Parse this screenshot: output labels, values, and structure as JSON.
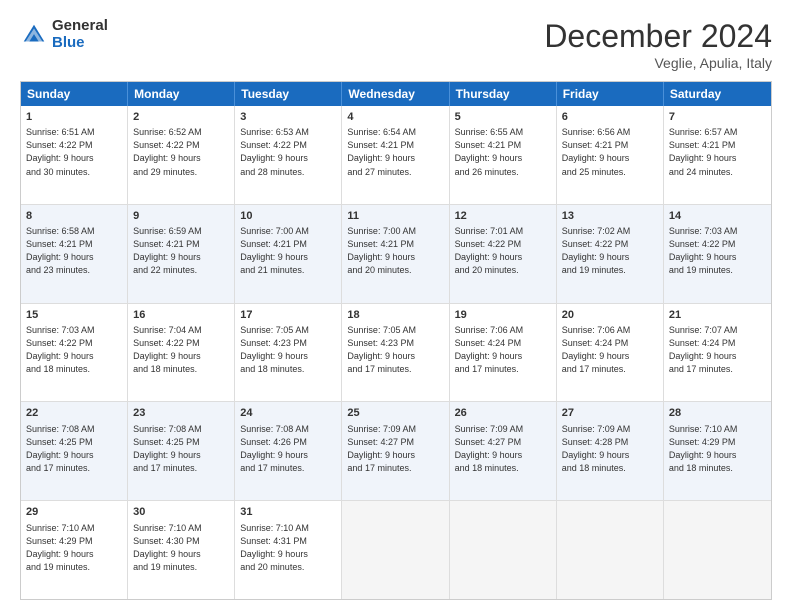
{
  "logo": {
    "general": "General",
    "blue": "Blue"
  },
  "title": {
    "month": "December 2024",
    "location": "Veglie, Apulia, Italy"
  },
  "headers": [
    "Sunday",
    "Monday",
    "Tuesday",
    "Wednesday",
    "Thursday",
    "Friday",
    "Saturday"
  ],
  "rows": [
    [
      {
        "day": "1",
        "info": "Sunrise: 6:51 AM\nSunset: 4:22 PM\nDaylight: 9 hours\nand 30 minutes.",
        "alt": false
      },
      {
        "day": "2",
        "info": "Sunrise: 6:52 AM\nSunset: 4:22 PM\nDaylight: 9 hours\nand 29 minutes.",
        "alt": false
      },
      {
        "day": "3",
        "info": "Sunrise: 6:53 AM\nSunset: 4:22 PM\nDaylight: 9 hours\nand 28 minutes.",
        "alt": false
      },
      {
        "day": "4",
        "info": "Sunrise: 6:54 AM\nSunset: 4:21 PM\nDaylight: 9 hours\nand 27 minutes.",
        "alt": false
      },
      {
        "day": "5",
        "info": "Sunrise: 6:55 AM\nSunset: 4:21 PM\nDaylight: 9 hours\nand 26 minutes.",
        "alt": false
      },
      {
        "day": "6",
        "info": "Sunrise: 6:56 AM\nSunset: 4:21 PM\nDaylight: 9 hours\nand 25 minutes.",
        "alt": false
      },
      {
        "day": "7",
        "info": "Sunrise: 6:57 AM\nSunset: 4:21 PM\nDaylight: 9 hours\nand 24 minutes.",
        "alt": false
      }
    ],
    [
      {
        "day": "8",
        "info": "Sunrise: 6:58 AM\nSunset: 4:21 PM\nDaylight: 9 hours\nand 23 minutes.",
        "alt": true
      },
      {
        "day": "9",
        "info": "Sunrise: 6:59 AM\nSunset: 4:21 PM\nDaylight: 9 hours\nand 22 minutes.",
        "alt": true
      },
      {
        "day": "10",
        "info": "Sunrise: 7:00 AM\nSunset: 4:21 PM\nDaylight: 9 hours\nand 21 minutes.",
        "alt": true
      },
      {
        "day": "11",
        "info": "Sunrise: 7:00 AM\nSunset: 4:21 PM\nDaylight: 9 hours\nand 20 minutes.",
        "alt": true
      },
      {
        "day": "12",
        "info": "Sunrise: 7:01 AM\nSunset: 4:22 PM\nDaylight: 9 hours\nand 20 minutes.",
        "alt": true
      },
      {
        "day": "13",
        "info": "Sunrise: 7:02 AM\nSunset: 4:22 PM\nDaylight: 9 hours\nand 19 minutes.",
        "alt": true
      },
      {
        "day": "14",
        "info": "Sunrise: 7:03 AM\nSunset: 4:22 PM\nDaylight: 9 hours\nand 19 minutes.",
        "alt": true
      }
    ],
    [
      {
        "day": "15",
        "info": "Sunrise: 7:03 AM\nSunset: 4:22 PM\nDaylight: 9 hours\nand 18 minutes.",
        "alt": false
      },
      {
        "day": "16",
        "info": "Sunrise: 7:04 AM\nSunset: 4:22 PM\nDaylight: 9 hours\nand 18 minutes.",
        "alt": false
      },
      {
        "day": "17",
        "info": "Sunrise: 7:05 AM\nSunset: 4:23 PM\nDaylight: 9 hours\nand 18 minutes.",
        "alt": false
      },
      {
        "day": "18",
        "info": "Sunrise: 7:05 AM\nSunset: 4:23 PM\nDaylight: 9 hours\nand 17 minutes.",
        "alt": false
      },
      {
        "day": "19",
        "info": "Sunrise: 7:06 AM\nSunset: 4:24 PM\nDaylight: 9 hours\nand 17 minutes.",
        "alt": false
      },
      {
        "day": "20",
        "info": "Sunrise: 7:06 AM\nSunset: 4:24 PM\nDaylight: 9 hours\nand 17 minutes.",
        "alt": false
      },
      {
        "day": "21",
        "info": "Sunrise: 7:07 AM\nSunset: 4:24 PM\nDaylight: 9 hours\nand 17 minutes.",
        "alt": false
      }
    ],
    [
      {
        "day": "22",
        "info": "Sunrise: 7:08 AM\nSunset: 4:25 PM\nDaylight: 9 hours\nand 17 minutes.",
        "alt": true
      },
      {
        "day": "23",
        "info": "Sunrise: 7:08 AM\nSunset: 4:25 PM\nDaylight: 9 hours\nand 17 minutes.",
        "alt": true
      },
      {
        "day": "24",
        "info": "Sunrise: 7:08 AM\nSunset: 4:26 PM\nDaylight: 9 hours\nand 17 minutes.",
        "alt": true
      },
      {
        "day": "25",
        "info": "Sunrise: 7:09 AM\nSunset: 4:27 PM\nDaylight: 9 hours\nand 17 minutes.",
        "alt": true
      },
      {
        "day": "26",
        "info": "Sunrise: 7:09 AM\nSunset: 4:27 PM\nDaylight: 9 hours\nand 18 minutes.",
        "alt": true
      },
      {
        "day": "27",
        "info": "Sunrise: 7:09 AM\nSunset: 4:28 PM\nDaylight: 9 hours\nand 18 minutes.",
        "alt": true
      },
      {
        "day": "28",
        "info": "Sunrise: 7:10 AM\nSunset: 4:29 PM\nDaylight: 9 hours\nand 18 minutes.",
        "alt": true
      }
    ],
    [
      {
        "day": "29",
        "info": "Sunrise: 7:10 AM\nSunset: 4:29 PM\nDaylight: 9 hours\nand 19 minutes.",
        "alt": false
      },
      {
        "day": "30",
        "info": "Sunrise: 7:10 AM\nSunset: 4:30 PM\nDaylight: 9 hours\nand 19 minutes.",
        "alt": false
      },
      {
        "day": "31",
        "info": "Sunrise: 7:10 AM\nSunset: 4:31 PM\nDaylight: 9 hours\nand 20 minutes.",
        "alt": false
      },
      {
        "day": "",
        "info": "",
        "alt": false,
        "empty": true
      },
      {
        "day": "",
        "info": "",
        "alt": false,
        "empty": true
      },
      {
        "day": "",
        "info": "",
        "alt": false,
        "empty": true
      },
      {
        "day": "",
        "info": "",
        "alt": false,
        "empty": true
      }
    ]
  ]
}
